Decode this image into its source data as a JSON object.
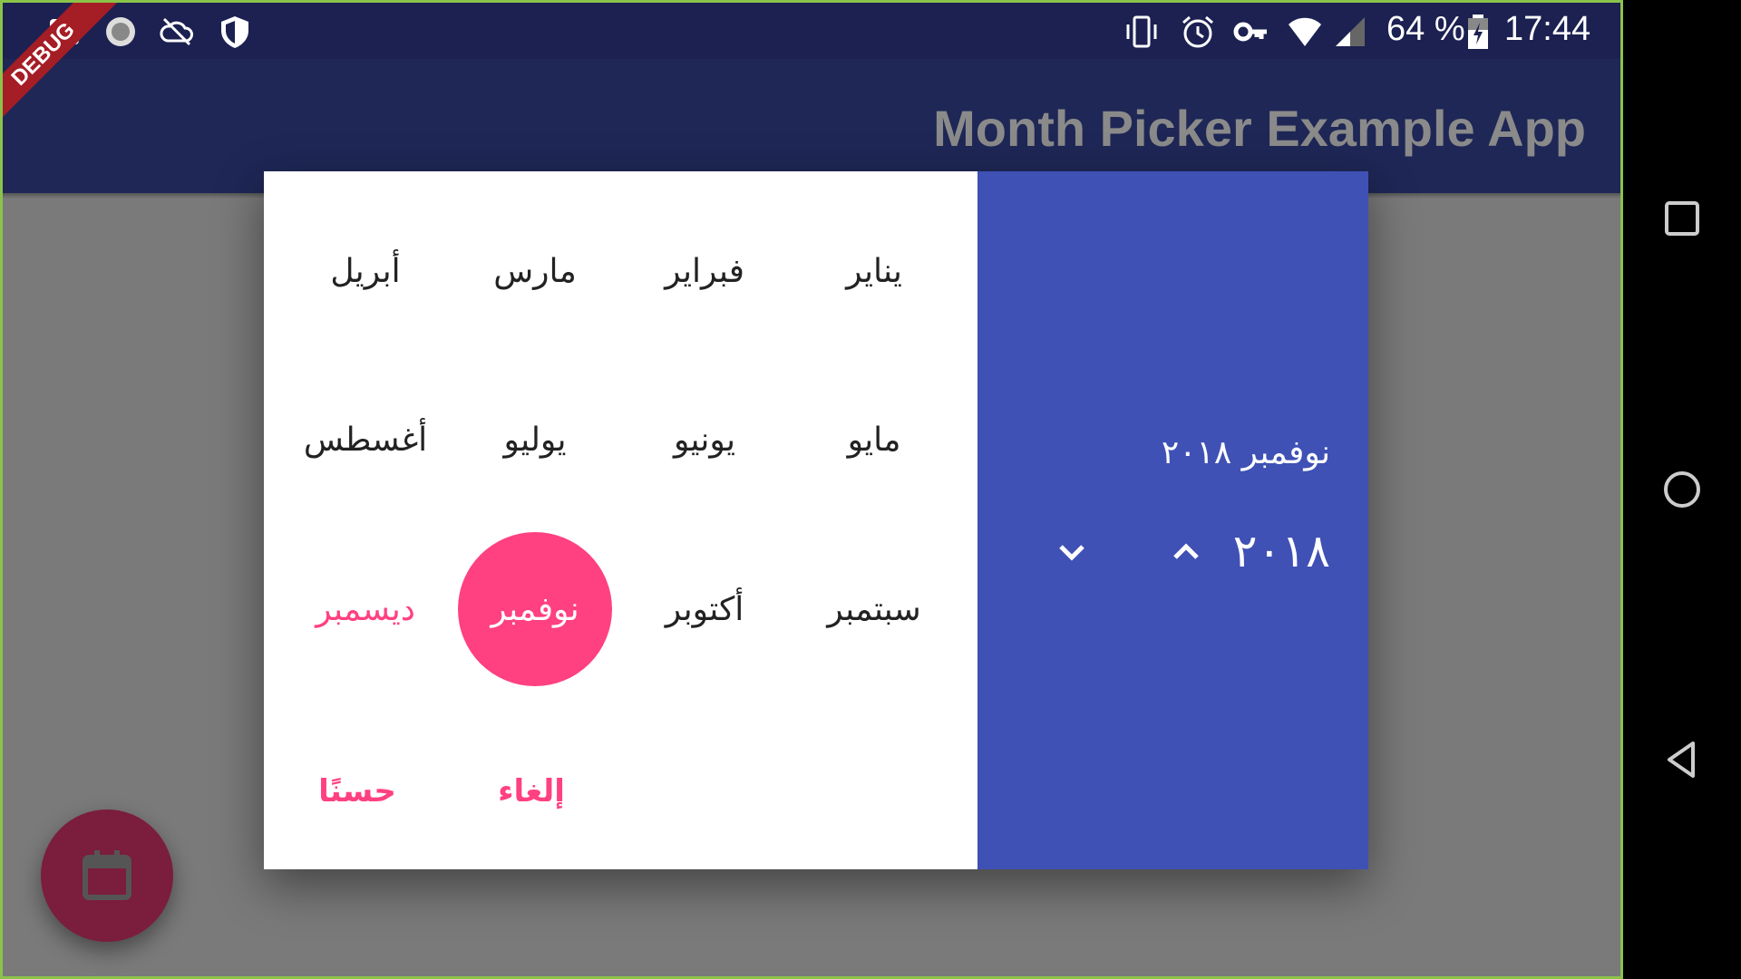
{
  "status_bar": {
    "battery": "64 %",
    "time": "17:44",
    "icons": [
      "gallery-icon",
      "sync-icon",
      "cloud-off-icon",
      "shield-icon",
      "vibrate-icon",
      "alarm-icon",
      "key-icon",
      "wifi-icon",
      "signal-icon",
      "battery-icon"
    ]
  },
  "debug_banner": "DEBUG",
  "app_bar": {
    "title": "Month Picker Example App"
  },
  "dialog": {
    "months": [
      {
        "label": "يناير"
      },
      {
        "label": "فبراير"
      },
      {
        "label": "مارس"
      },
      {
        "label": "أبريل"
      },
      {
        "label": "مايو"
      },
      {
        "label": "يونيو"
      },
      {
        "label": "يوليو"
      },
      {
        "label": "أغسطس"
      },
      {
        "label": "سبتمبر"
      },
      {
        "label": "أكتوبر"
      },
      {
        "label": "نوفمبر",
        "selected": true
      },
      {
        "label": "ديسمبر",
        "future": true
      }
    ],
    "header_month_year": "نوفمبر ٢٠١٨",
    "header_year": "٢٠١٨",
    "cancel_label": "إلغاء",
    "ok_label": "حسنًا",
    "colors": {
      "accent": "#ff4081",
      "header": "#3f51b5"
    }
  },
  "fab": {
    "icon": "calendar-icon"
  },
  "nav_bar": {
    "icons": [
      "recents-icon",
      "home-icon",
      "back-icon"
    ]
  }
}
